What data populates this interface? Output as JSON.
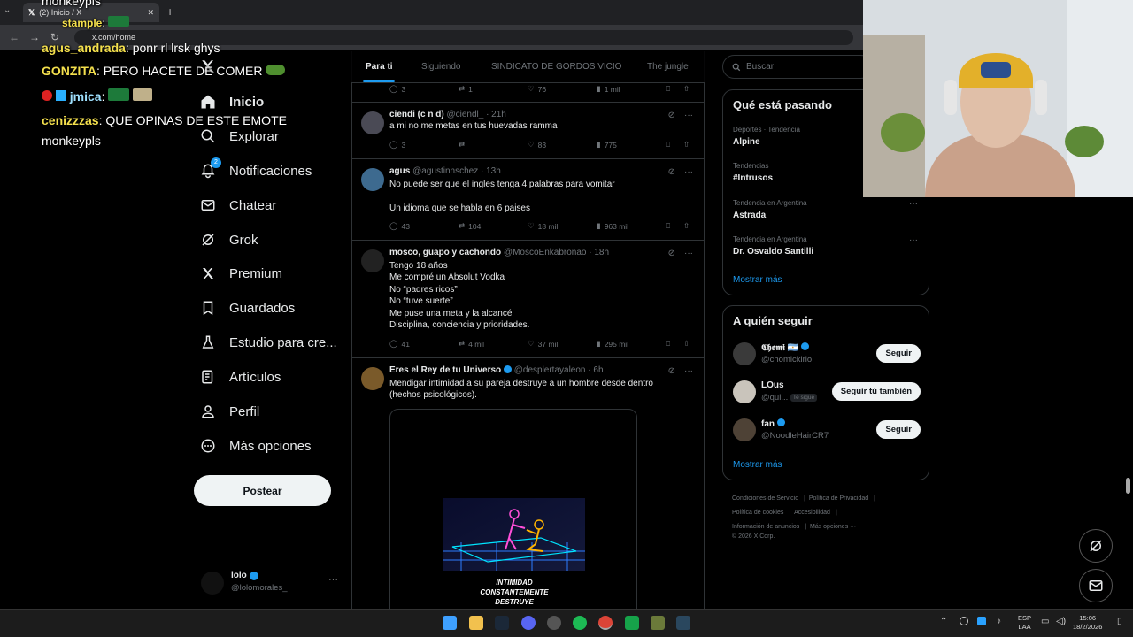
{
  "browser": {
    "tab_title": "(2) Inicio / X",
    "url": "x.com/home"
  },
  "chat_overlay": [
    {
      "user": "monkeypls",
      "message": ""
    },
    {
      "user": "stample",
      "message": ":"
    },
    {
      "user": "agus_andrada",
      "message": ": ponr rl lrsk ghys"
    },
    {
      "user": "GONZITA",
      "message": ": PERO HACETE DE COMER"
    },
    {
      "user": "jmica",
      "message": ":"
    },
    {
      "user": "cenizzzas",
      "message": ": QUE OPINAS DE ESTE EMOTE"
    },
    {
      "user": "",
      "message": "monkeypls"
    }
  ],
  "nav": {
    "items": [
      {
        "label": "Inicio",
        "icon": "home-icon"
      },
      {
        "label": "Explorar",
        "icon": "search-icon"
      },
      {
        "label": "Notificaciones",
        "icon": "bell-icon",
        "badge": "2"
      },
      {
        "label": "Chatear",
        "icon": "mail-icon"
      },
      {
        "label": "Grok",
        "icon": "grok-icon"
      },
      {
        "label": "Premium",
        "icon": "x-logo-icon"
      },
      {
        "label": "Guardados",
        "icon": "bookmark-icon"
      },
      {
        "label": "Estudio para cre...",
        "icon": "flask-icon"
      },
      {
        "label": "Artículos",
        "icon": "article-icon"
      },
      {
        "label": "Perfil",
        "icon": "person-icon"
      },
      {
        "label": "Más opciones",
        "icon": "more-circle-icon"
      }
    ],
    "post_button": "Postear",
    "account": {
      "name": "lolo",
      "handle": "@lolomorales_"
    }
  },
  "feed": {
    "tabs": [
      "Para ti",
      "Siguiendo",
      "SINDICATO DE GORDOS VICIO",
      "The jungle"
    ],
    "top_actions": {
      "replies": "3",
      "reposts": "1",
      "likes": "76",
      "views": "1 mil"
    },
    "tweets": [
      {
        "name": "ciendi (c n d)",
        "handle": "@ciendl_",
        "time": "· 21h",
        "lines": [
          "a mi no me metas en tus huevadas ramma"
        ],
        "replies": "3",
        "reposts": "",
        "likes": "83",
        "views": "775"
      },
      {
        "name": "agus",
        "handle": "@agustinnschez",
        "time": "· 13h",
        "lines": [
          "No puede ser que el ingles tenga 4 palabras para vomitar",
          "",
          "Un idioma que se habla en 6 paises"
        ],
        "replies": "43",
        "reposts": "104",
        "likes": "18 mil",
        "views": "963 mil"
      },
      {
        "name": "mosco, guapo y cachondo",
        "handle": "@MoscoEnkabronao",
        "time": "· 18h",
        "lines": [
          "Tengo 18 años",
          "Me compré un Absolut Vodka",
          "No “padres ricos”",
          "No “tuve suerte”",
          "Me puse una meta y la alcancé",
          "Disciplina, conciencia y prioridades."
        ],
        "replies": "41",
        "reposts": "4 mil",
        "likes": "37 mil",
        "views": "295 mil"
      },
      {
        "name": "Eres el Rey de tu Universo",
        "handle": "@desplertayaleon",
        "time": "· 6h",
        "lines": [
          "Mendigar intimidad a su pareja destruye a un hombre desde dentro",
          "(hechos psicológicos)."
        ],
        "image_caption": [
          "INTIMIDAD",
          "CONSTANTEMENTE",
          "DESTRUYE"
        ]
      }
    ]
  },
  "sidebar": {
    "search_placeholder": "Buscar",
    "trends_title": "Qué está pasando",
    "trends": [
      {
        "context": "Deportes · Tendencia",
        "topic": "Alpine"
      },
      {
        "context": "Tendencias",
        "topic": "#Intrusos"
      },
      {
        "context": "Tendencia en Argentina",
        "topic": "Astrada"
      },
      {
        "context": "Tendencia en Argentina",
        "topic": "Dr. Osvaldo Santilli"
      }
    ],
    "show_more": "Mostrar más",
    "follow_title": "A quién seguir",
    "follow": [
      {
        "name": "𝕮𝖍𝖔𝖒𝖎 🇦🇷",
        "handle": "@chomickirio",
        "button": "Seguir",
        "verified": true
      },
      {
        "name": "LOus",
        "handle": "@qui...",
        "badge": "Te sigue",
        "button": "Seguir tú también",
        "verified": false
      },
      {
        "name": "fan",
        "handle": "@NoodleHairCR7",
        "button": "Seguir",
        "verified": true
      }
    ],
    "show_more2": "Mostrar más",
    "footer": [
      "Condiciones de Servicio",
      "Política de Privacidad",
      "Política de cookies",
      "Accesibilidad",
      "Información de anuncios",
      "Más opciones ···",
      "© 2026 X Corp."
    ]
  },
  "taskbar": {
    "lang": "ESP",
    "layout": "LAA",
    "time": "15:06",
    "date": "18/2/2026"
  },
  "colors": {
    "accent": "#1d9bf0",
    "background": "#000000",
    "border": "#2f3336",
    "muted": "#71767b"
  }
}
